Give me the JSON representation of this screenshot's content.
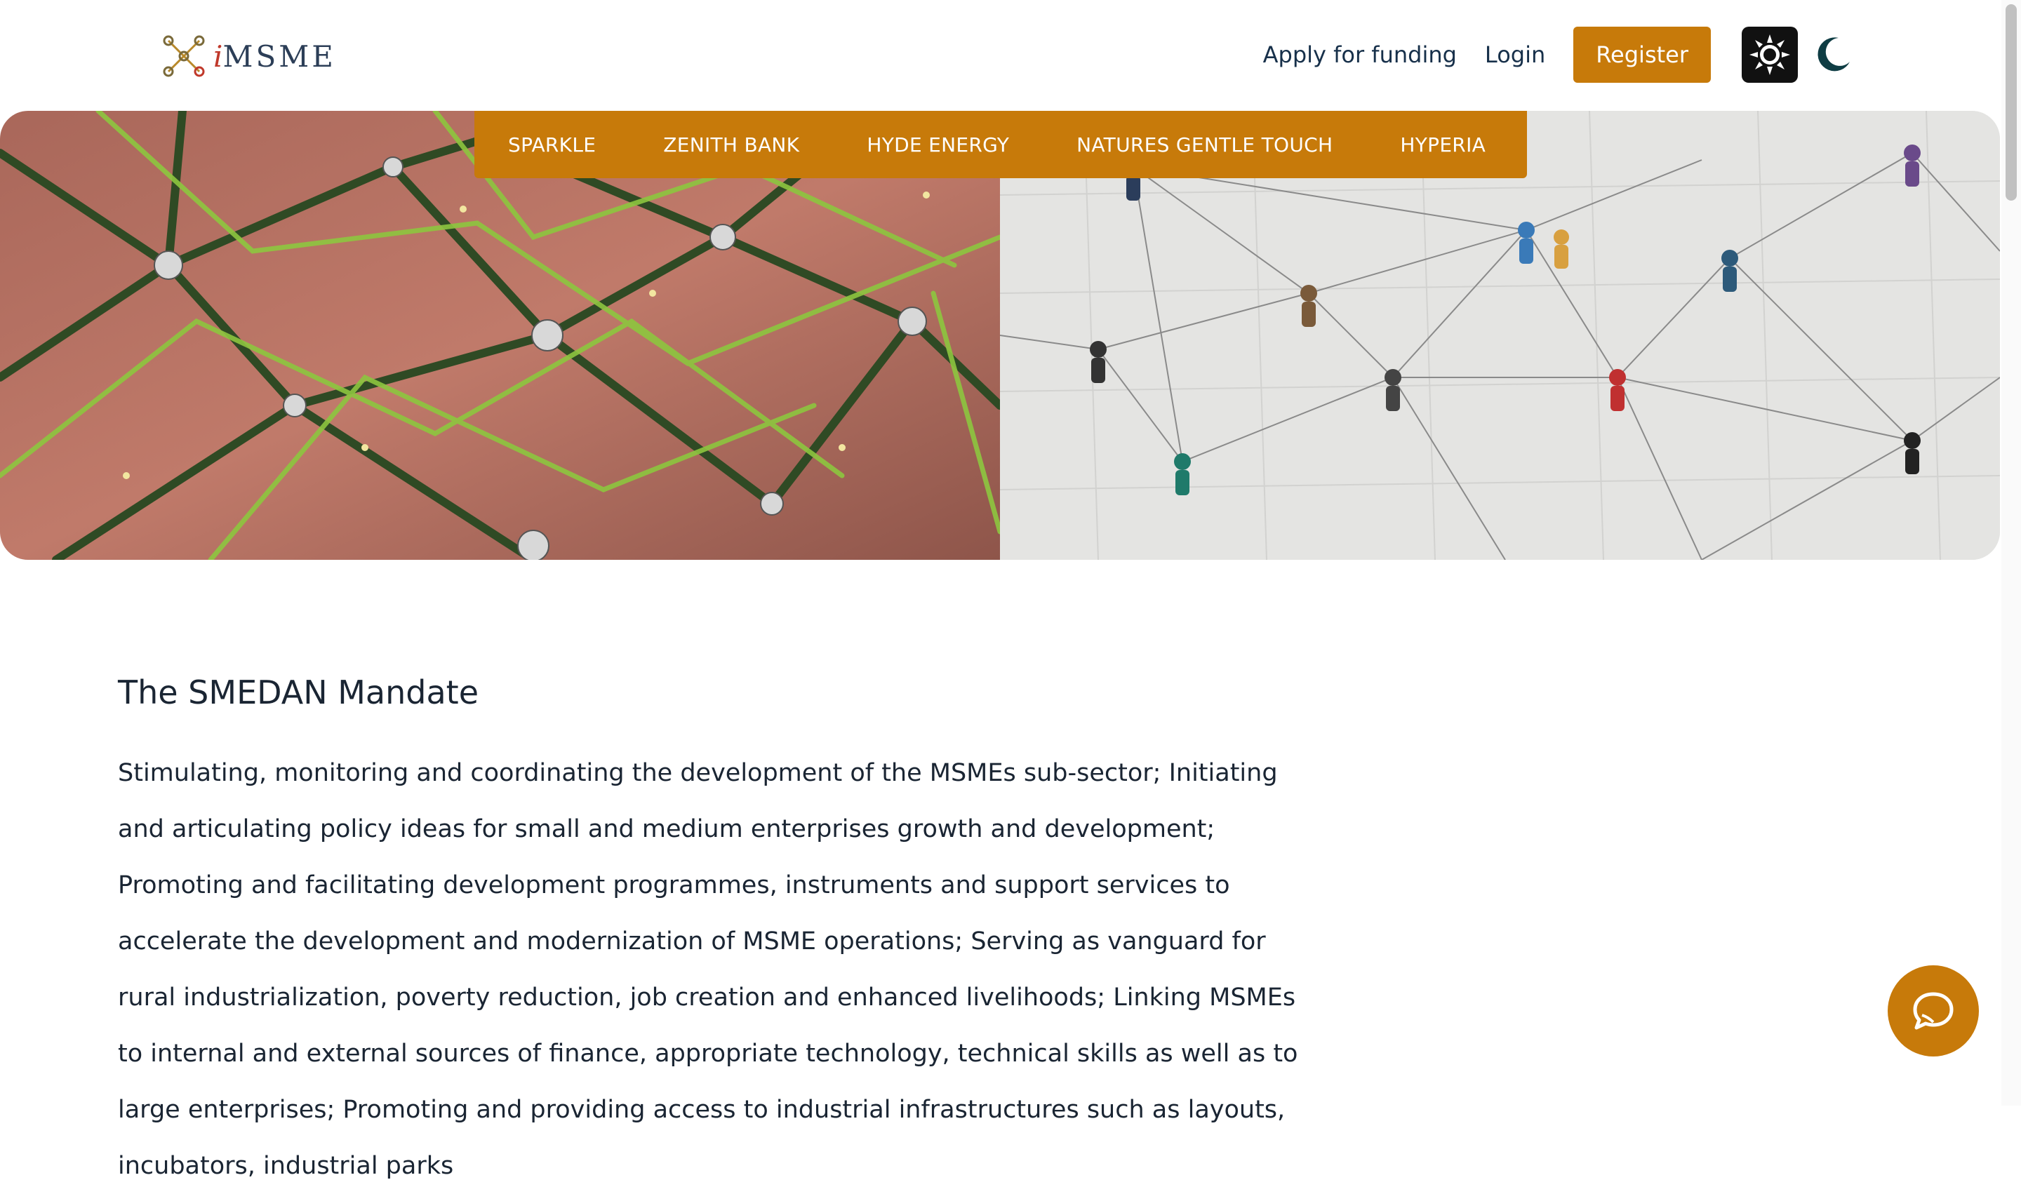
{
  "header": {
    "logo_text_prefix": "i",
    "logo_text_main": "MSME",
    "apply_label": "Apply for funding",
    "login_label": "Login",
    "register_label": "Register"
  },
  "partners": [
    {
      "label": "SPARKLE"
    },
    {
      "label": "ZENITH BANK"
    },
    {
      "label": "HYDE ENERGY"
    },
    {
      "label": "NATURES GENTLE TOUCH"
    },
    {
      "label": "HYPERIA"
    }
  ],
  "main": {
    "title": "The SMEDAN Mandate",
    "body": "Stimulating, monitoring and coordinating the development of the MSMEs sub-sector; Initiating and articulating policy ideas for small and medium enterprises growth and development; Promoting and facilitating development programmes, instruments and support services to accelerate the development and modernization of MSME operations; Serving as vanguard for rural industrialization, poverty reduction, job creation and enhanced livelihoods; Linking MSMEs to internal and external sources of finance, appropriate technology, technical skills as well as to large enterprises; Promoting and providing access to industrial infrastructures such as layouts, incubators, industrial parks"
  },
  "colors": {
    "accent": "#c77a0a",
    "text": "#1a2533",
    "nav_text": "#17304a"
  },
  "icons": {
    "sun": "sun-icon",
    "moon": "moon-icon",
    "chat": "chat-bubble-icon",
    "logo": "network-nodes-icon"
  }
}
